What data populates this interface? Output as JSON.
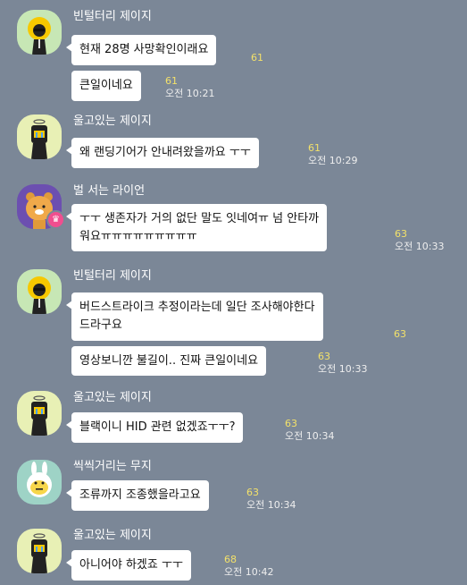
{
  "colors": {
    "background": "#7b8797",
    "bubble": "#ffffff",
    "unread_count": "#f3e16a",
    "crown_badge": "#f04e8f"
  },
  "messages": [
    {
      "sender": "빈털터리 제이지",
      "avatar_icon": "jayg-avatar-icon",
      "bubbles": [
        {
          "text": "현재 28명 사망확인이래요",
          "count": "61",
          "time": ""
        },
        {
          "text": "큰일이네요",
          "count": "61",
          "time": "오전 10:21"
        }
      ]
    },
    {
      "sender": "울고있는 제이지",
      "avatar_icon": "crying-jayg-avatar-icon",
      "bubbles": [
        {
          "text": "왜 랜딩기어가 안내려왔을까요 ㅜㅜ",
          "count": "61",
          "time": "오전 10:29"
        }
      ]
    },
    {
      "sender": "벌 서는 라이언",
      "avatar_icon": "ryan-avatar-icon",
      "badge_icon": "crown-icon",
      "bubbles": [
        {
          "lines": [
            "ㅜㅜ 생존자가 거의 없단 말도 잇네여ㅠ 넘 안타까",
            "워요ㅠㅠㅠㅠㅠㅠㅠㅠㅠ"
          ],
          "count": "63",
          "time": "오전 10:33"
        }
      ]
    },
    {
      "sender": "빈털터리 제이지",
      "avatar_icon": "jayg-avatar-icon",
      "bubbles": [
        {
          "lines": [
            "버드스트라이크 추정이라는데 일단 조사해야한다",
            "드라구요"
          ],
          "count": "63",
          "time": ""
        },
        {
          "text": "영상보니깐 불길이.. 진짜 큰일이네요",
          "count": "63",
          "time": "오전 10:33"
        }
      ]
    },
    {
      "sender": "울고있는 제이지",
      "avatar_icon": "crying-jayg-avatar-icon",
      "bubbles": [
        {
          "text": "블랙이니 HID 관련 없겠죠ㅜㅜ?",
          "count": "63",
          "time": "오전 10:34"
        }
      ]
    },
    {
      "sender": "씩씩거리는 무지",
      "avatar_icon": "muzi-avatar-icon",
      "bubbles": [
        {
          "text": "조류까지 조종했을라고요",
          "count": "63",
          "time": "오전 10:34"
        }
      ]
    },
    {
      "sender": "울고있는 제이지",
      "avatar_icon": "crying-jayg-avatar-icon",
      "bubbles": [
        {
          "text": "아니어야 하겠죠 ㅜㅜ",
          "count": "68",
          "time": "오전 10:42"
        }
      ]
    }
  ]
}
